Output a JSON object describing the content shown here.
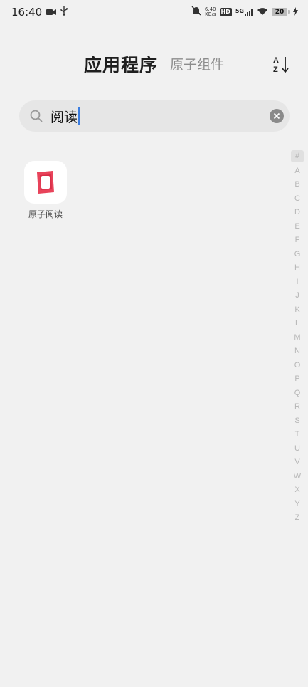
{
  "status_bar": {
    "time": "16:40",
    "net_speed_value": "6.40",
    "net_speed_unit": "KB/s",
    "hd": "HD",
    "network": "5G",
    "battery": "20"
  },
  "header": {
    "title": "应用程序",
    "subtitle": "原子组件"
  },
  "search": {
    "value": "阅读"
  },
  "apps": [
    {
      "label": "原子阅读",
      "icon": "red-book-icon",
      "accent": "#e8435a"
    }
  ],
  "alpha_index": [
    "#",
    "A",
    "B",
    "C",
    "D",
    "E",
    "F",
    "G",
    "H",
    "I",
    "J",
    "K",
    "L",
    "M",
    "N",
    "O",
    "P",
    "Q",
    "R",
    "S",
    "T",
    "U",
    "V",
    "W",
    "X",
    "Y",
    "Z"
  ]
}
